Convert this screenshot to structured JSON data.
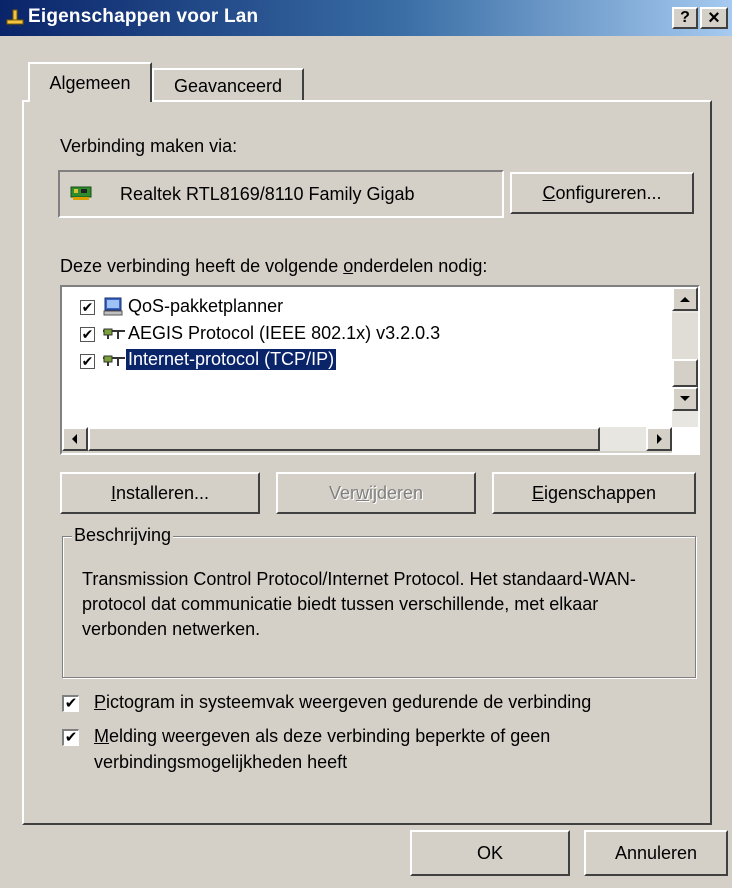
{
  "window": {
    "title": "Eigenschappen voor Lan",
    "help_label": "?",
    "close_label": "×"
  },
  "tabs": [
    {
      "label": "Algemeen",
      "active": true
    },
    {
      "label": "Geavanceerd",
      "active": false
    }
  ],
  "connect_via": {
    "label": "Verbinding maken via:",
    "adapter": "Realtek RTL8169/8110 Family Gigab",
    "configure_button": {
      "pre": "",
      "accel": "C",
      "post": "onfigureren..."
    }
  },
  "components": {
    "label_pre": "Deze verbinding heeft de volgende ",
    "label_accel": "o",
    "label_post": "nderdelen nodig:",
    "items": [
      {
        "label": "QoS-pakketplanner",
        "checked": true,
        "icon": "scheduler-icon",
        "selected": false
      },
      {
        "label": "AEGIS Protocol (IEEE 802.1x) v3.2.0.3",
        "checked": true,
        "icon": "protocol-icon",
        "selected": false
      },
      {
        "label": "Internet-protocol (TCP/IP)",
        "checked": true,
        "icon": "protocol-icon",
        "selected": true
      }
    ]
  },
  "buttons": {
    "install": {
      "pre": "",
      "accel": "I",
      "post": "nstalleren..."
    },
    "remove": {
      "pre": "Ver",
      "accel": "w",
      "post": "ijderen",
      "enabled": false
    },
    "properties": {
      "pre": "",
      "accel": "E",
      "post": "igenschappen"
    }
  },
  "description": {
    "legend": "Beschrijving",
    "text": "Transmission Control Protocol/Internet Protocol. Het standaard-WAN-protocol dat communicatie biedt tussen verschillende, met elkaar verbonden netwerken."
  },
  "options": [
    {
      "accel": "P",
      "post": "ictogram in systeemvak weergeven gedurende de verbinding",
      "checked": true
    },
    {
      "accel": "M",
      "post": "elding weergeven als deze verbinding beperkte of geen",
      "line2": "verbindingsmogelijkheden heeft",
      "checked": true
    }
  ],
  "footer": {
    "ok": "OK",
    "cancel": "Annuleren"
  },
  "colors": {
    "face": "#d4d0c8",
    "title_start": "#0a246a",
    "title_end": "#a6caf0",
    "selection": "#0a246a"
  }
}
